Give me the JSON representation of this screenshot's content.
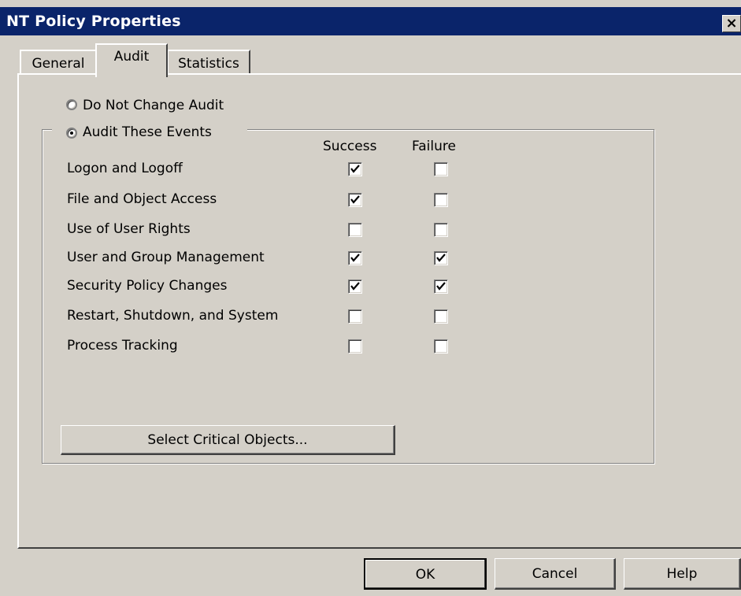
{
  "window": {
    "title": "NT Policy Properties",
    "close_glyph": "×"
  },
  "tabs": [
    {
      "label": "General",
      "selected": false
    },
    {
      "label": "Audit",
      "selected": true
    },
    {
      "label": "Statistics",
      "selected": false
    }
  ],
  "audit": {
    "option_do_not_change": "Do Not Change Audit",
    "option_audit_events": "Audit These Events",
    "selected_option": "Audit These Events",
    "col_success": "Success",
    "col_failure": "Failure",
    "events": [
      {
        "label": "Logon and Logoff",
        "success": true,
        "failure": false
      },
      {
        "label": "File and Object Access",
        "success": true,
        "failure": false
      },
      {
        "label": "Use of User Rights",
        "success": false,
        "failure": false
      },
      {
        "label": "User and Group Management",
        "success": true,
        "failure": true
      },
      {
        "label": "Security Policy Changes",
        "success": true,
        "failure": true
      },
      {
        "label": "Restart, Shutdown, and System",
        "success": false,
        "failure": false
      },
      {
        "label": "Process Tracking",
        "success": false,
        "failure": false
      }
    ],
    "critical_button": "Select Critical Objects..."
  },
  "buttons": {
    "ok": "OK",
    "cancel": "Cancel",
    "help": "Help"
  },
  "colors": {
    "titlebar": "#0a246a",
    "face": "#d4d0c8"
  }
}
